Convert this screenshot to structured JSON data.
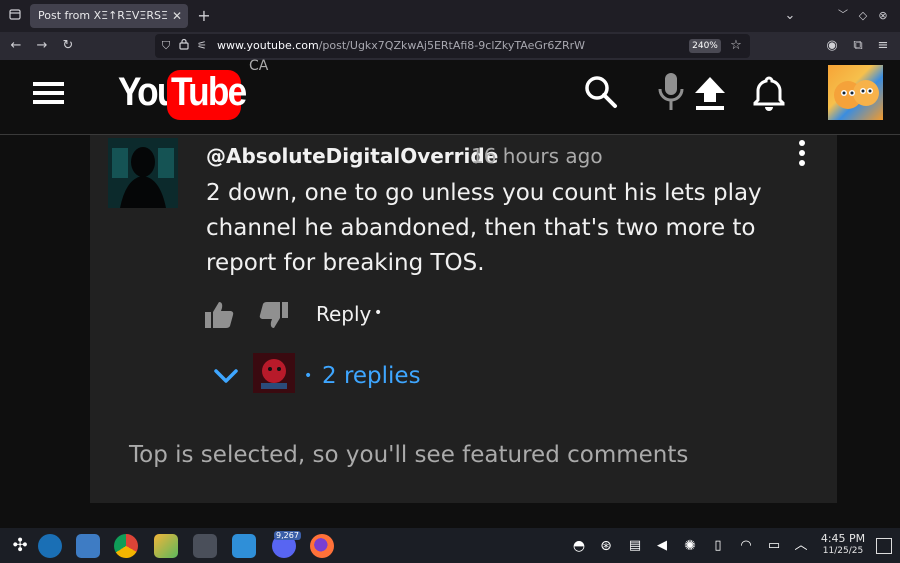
{
  "browser": {
    "tab_title": "Post from XΞ↑RΞVΞRSΞ ×Ξ↑",
    "url_domain": "www.youtube.com",
    "url_path": "/post/Ugkx7QZkwAj5ERtAfi8-9clZkyTAeGr6ZRrW",
    "zoom": "240%"
  },
  "header": {
    "logo_you": "You",
    "logo_tube": "Tube",
    "region": "CA"
  },
  "comment": {
    "author": "@AbsoluteDigitalOverride",
    "time": "16 hours ago",
    "text": "2 down, one to go unless you count his lets play channel he abandoned, then that's two more to report for breaking TOS.",
    "reply_label": "Reply",
    "replies_label": "2 replies"
  },
  "footer_note": "Top is selected, so you'll see featured comments",
  "taskbar": {
    "badge": "9,267",
    "time": "4:45 PM",
    "date": "11/25/25"
  },
  "colors": {
    "youtube_red": "#ff0000",
    "link_blue": "#3ea6ff",
    "card_bg": "#212121",
    "page_bg": "#0f0f0f"
  }
}
